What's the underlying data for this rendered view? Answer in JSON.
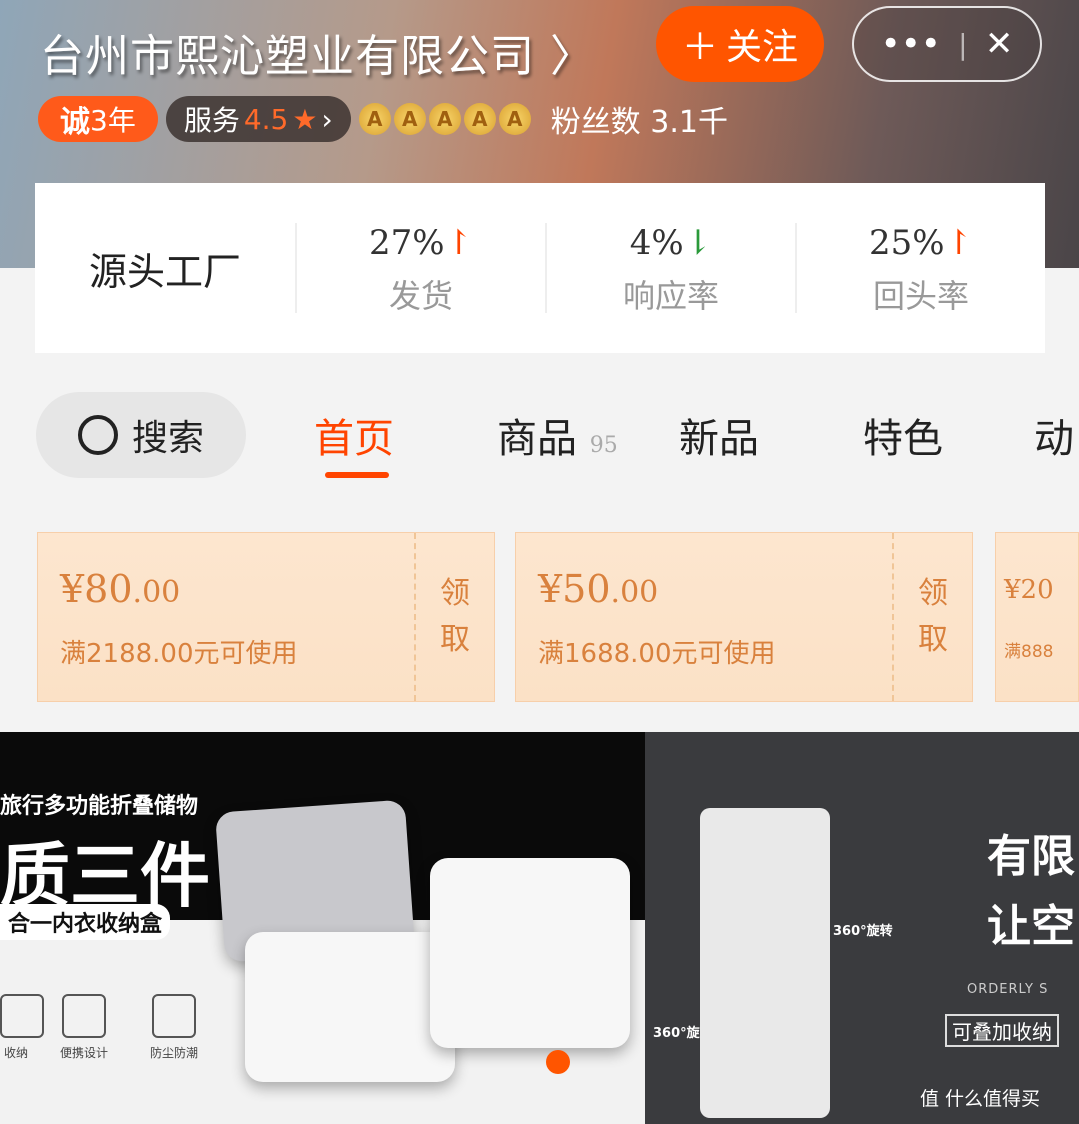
{
  "header": {
    "shop_name": "台州市熙沁塑业有限公司",
    "follow_label": "关注",
    "more_icon": "more-dots-icon",
    "close_icon": "close-icon"
  },
  "badges": {
    "cheng": "诚",
    "years": "3年",
    "service_label": "服务",
    "service_score": "4.5",
    "medal_letter": "A",
    "medal_count": 5,
    "fans_label": "粉丝数",
    "fans_count": "3.1千"
  },
  "stats": {
    "source": "源头工厂",
    "items": [
      {
        "value": "27%",
        "label": "发货",
        "trend": "up"
      },
      {
        "value": "4%",
        "label": "响应率",
        "trend": "down"
      },
      {
        "value": "25%",
        "label": "回头率",
        "trend": "up"
      }
    ]
  },
  "tabs": {
    "search_label": "搜索",
    "items": [
      {
        "label": "首页",
        "active": true
      },
      {
        "label": "商品",
        "count": "95"
      },
      {
        "label": "新品"
      },
      {
        "label": "特色"
      },
      {
        "label": "动"
      }
    ]
  },
  "coupons": [
    {
      "amount": "¥80",
      "cents": ".00",
      "condition": "满2188.00元可使用",
      "action": [
        "领",
        "取"
      ]
    },
    {
      "amount": "¥50",
      "cents": ".00",
      "condition": "满1688.00元可使用",
      "action": [
        "领",
        "取"
      ]
    },
    {
      "amount": "¥20",
      "cents": "",
      "condition": "满888"
    }
  ],
  "banners": [
    {
      "line1": "旅行多功能折叠储物",
      "line2": "质三件",
      "line3": "合一内衣收纳盒",
      "features": [
        "收纳",
        "便携设计",
        "防尘防潮"
      ]
    },
    {
      "line1": "有限",
      "line2": "让空",
      "sub": "ORDERLY S",
      "tag": "可叠加收纳",
      "rotate": "360°旋转"
    }
  ],
  "watermark": "值 什么值得买",
  "colors": {
    "accent": "#ff5500",
    "coupon_text": "#d9813d"
  }
}
